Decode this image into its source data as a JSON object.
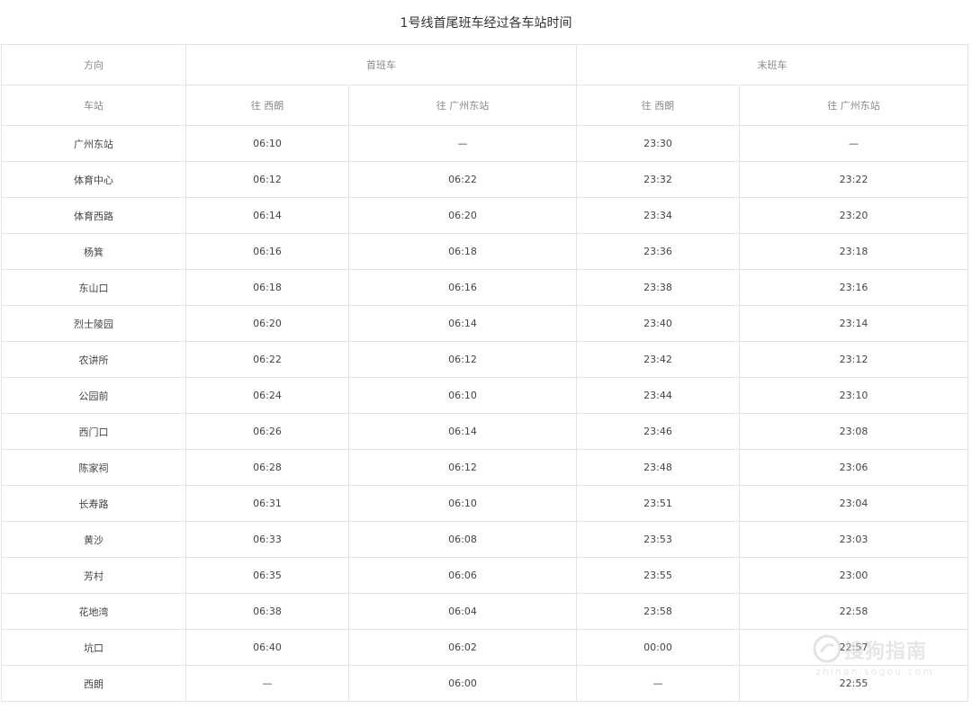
{
  "title": "1号线首尾班车经过各车站时间",
  "header": {
    "direction_label": "方向",
    "first_train_label": "首班车",
    "last_train_label": "末班车",
    "station_label": "车站",
    "first_to_xilang": "往 西朗",
    "first_to_gzeast": "往 广州东站",
    "last_to_xilang": "往 西朗",
    "last_to_gzeast": "往 广州东站"
  },
  "rows": [
    {
      "station": "广州东站",
      "first_xilang": "06:10",
      "first_gzeast": "—",
      "last_xilang": "23:30",
      "last_gzeast": "—"
    },
    {
      "station": "体育中心",
      "first_xilang": "06:12",
      "first_gzeast": "06:22",
      "last_xilang": "23:32",
      "last_gzeast": "23:22"
    },
    {
      "station": "体育西路",
      "first_xilang": "06:14",
      "first_gzeast": "06:20",
      "last_xilang": "23:34",
      "last_gzeast": "23:20"
    },
    {
      "station": "杨箕",
      "first_xilang": "06:16",
      "first_gzeast": "06:18",
      "last_xilang": "23:36",
      "last_gzeast": "23:18"
    },
    {
      "station": "东山口",
      "first_xilang": "06:18",
      "first_gzeast": "06:16",
      "last_xilang": "23:38",
      "last_gzeast": "23:16"
    },
    {
      "station": "烈士陵园",
      "first_xilang": "06:20",
      "first_gzeast": "06:14",
      "last_xilang": "23:40",
      "last_gzeast": "23:14"
    },
    {
      "station": "农讲所",
      "first_xilang": "06:22",
      "first_gzeast": "06:12",
      "last_xilang": "23:42",
      "last_gzeast": "23:12"
    },
    {
      "station": "公园前",
      "first_xilang": "06:24",
      "first_gzeast": "06:10",
      "last_xilang": "23:44",
      "last_gzeast": "23:10"
    },
    {
      "station": "西门口",
      "first_xilang": "06:26",
      "first_gzeast": "06:14",
      "last_xilang": "23:46",
      "last_gzeast": "23:08"
    },
    {
      "station": "陈家祠",
      "first_xilang": "06:28",
      "first_gzeast": "06:12",
      "last_xilang": "23:48",
      "last_gzeast": "23:06"
    },
    {
      "station": "长寿路",
      "first_xilang": "06:31",
      "first_gzeast": "06:10",
      "last_xilang": "23:51",
      "last_gzeast": "23:04"
    },
    {
      "station": "黄沙",
      "first_xilang": "06:33",
      "first_gzeast": "06:08",
      "last_xilang": "23:53",
      "last_gzeast": "23:03"
    },
    {
      "station": "芳村",
      "first_xilang": "06:35",
      "first_gzeast": "06:06",
      "last_xilang": "23:55",
      "last_gzeast": "23:00"
    },
    {
      "station": "花地湾",
      "first_xilang": "06:38",
      "first_gzeast": "06:04",
      "last_xilang": "23:58",
      "last_gzeast": "22:58"
    },
    {
      "station": "坑口",
      "first_xilang": "06:40",
      "first_gzeast": "06:02",
      "last_xilang": "00:00",
      "last_gzeast": "22:57"
    },
    {
      "station": "西朗",
      "first_xilang": "—",
      "first_gzeast": "06:00",
      "last_xilang": "—",
      "last_gzeast": "22:55"
    }
  ],
  "watermark": {
    "brand": "搜狗指南",
    "url": "zhinan.sogou.com",
    "icon": "sogou-logo-icon"
  }
}
